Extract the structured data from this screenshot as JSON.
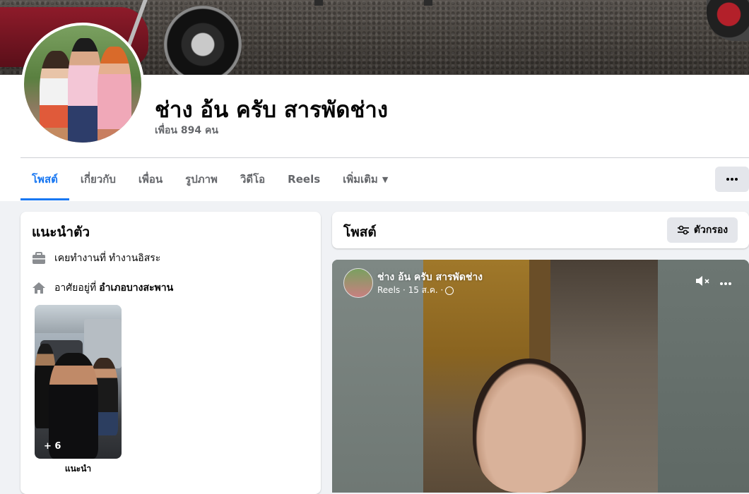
{
  "profile": {
    "name": "ช่าง อ้น ครับ สารพัดช่าง",
    "friends_text": "เพื่อน 894 คน"
  },
  "tabs": [
    {
      "label": "โพสต์",
      "active": true
    },
    {
      "label": "เกี่ยวกับ"
    },
    {
      "label": "เพื่อน"
    },
    {
      "label": "รูปภาพ"
    },
    {
      "label": "วิดีโอ"
    },
    {
      "label": "Reels"
    },
    {
      "label": "เพิ่มเติม"
    }
  ],
  "intro": {
    "title": "แนะนำตัว",
    "work_prefix": "เคยทำงานที่",
    "work_value": "ทำงานอิสระ",
    "home_prefix": "อาศัยอยู่ที่",
    "home_value": "อำเภอบางสะพาน",
    "photo_count": "+ 6",
    "photo_caption": "แนะนำ"
  },
  "posts": {
    "title": "โพสต์",
    "filter_label": "ตัวกรอง"
  },
  "reel": {
    "author": "ช่าง อ้น ครับ สารพัดช่าง",
    "meta": "Reels · 15 ส.ค. ·"
  },
  "colors": {
    "accent": "#1877f2",
    "secondary_text": "#65676b",
    "button_bg": "#e4e6eb",
    "page_bg": "#f0f2f5"
  },
  "icons": [
    "briefcase-icon",
    "home-icon",
    "more-icon",
    "filter-icon",
    "mute-icon",
    "globe-icon",
    "caret-down-icon"
  ]
}
